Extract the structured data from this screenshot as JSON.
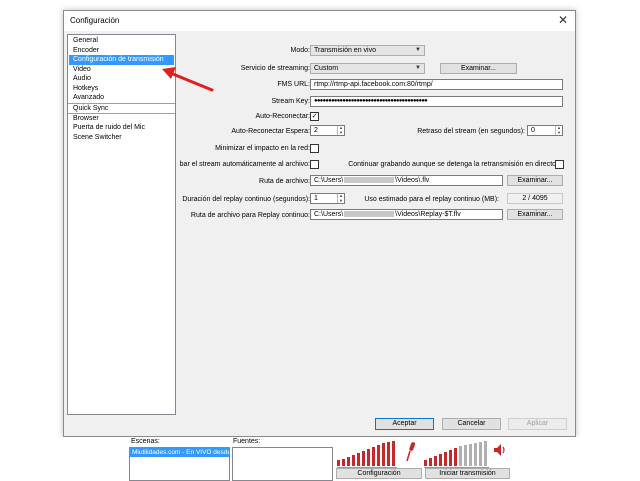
{
  "dialog": {
    "title": "Configuración",
    "close_glyph": "✕"
  },
  "sidebar": {
    "items": [
      {
        "label": "General"
      },
      {
        "label": "Encoder"
      },
      {
        "label": "Configuración de transmisión",
        "selected": true
      },
      {
        "label": "Video"
      },
      {
        "label": "Audio"
      },
      {
        "label": "Hotkeys"
      },
      {
        "label": "Avanzado"
      },
      {
        "label": "Quick Sync"
      },
      {
        "label": "Browser"
      },
      {
        "label": "Puerta de ruido del Mic"
      },
      {
        "label": "Scene Switcher"
      }
    ]
  },
  "form": {
    "modo_label": "Modo:",
    "modo_value": "Transmisión en vivo",
    "servicio_label": "Servicio de streaming:",
    "servicio_value": "Custom",
    "examinar1": "Examinar...",
    "fms_label": "FMS URL:",
    "fms_value": "rtmp://rtmp-api.facebook.com:80/rtmp/",
    "key_label": "Stream Key:",
    "key_value": "●●●●●●●●●●●●●●●●●●●●●●●●●●●●●●●●●●●●●●●●",
    "auto_reconectar_label": "Auto-Reconectar:",
    "auto_reconectar_checked": true,
    "auto_espera_label": "Auto-Reconectar Espera:",
    "auto_espera_value": "2",
    "retraso_label": "Retraso del stream (en segundos):",
    "retraso_value": "0",
    "minimizar_label": "Minimizar el impacto en la red:",
    "minimizar_checked": false,
    "grabar_label": "bar el stream automáticamente al archivo:",
    "grabar_checked": false,
    "continuar_label": "Continuar grabando aunque se detenga la retransmisión en directo:",
    "continuar_checked": false,
    "ruta_label": "Ruta de archivo:",
    "ruta_prefix": "C:\\Users\\",
    "ruta_suffix": "\\Videos\\.flv",
    "examinar2": "Examinar...",
    "duracion_label": "Duración del replay continuo (segundos):",
    "duracion_value": "1",
    "uso_label": "Uso estimado para el replay continuo (MB):",
    "uso_value": "2 / 4095",
    "replay_label": "Ruta de archivo para Replay continuo:",
    "replay_prefix": "C:\\Users\\",
    "replay_suffix": "\\Videos\\Replay-$T.flv",
    "examinar3": "Examinar..."
  },
  "footer": {
    "aceptar": "Aceptar",
    "cancelar": "Cancelar",
    "aplicar": "Aplicar"
  },
  "obs": {
    "escenas_label": "Escenas:",
    "escena_item": "Miutilidades.com - En VIVO desde",
    "fuentes_label": "Fuentes:",
    "configuracion_btn": "Configuración",
    "iniciar_btn": "Iniciar transmisión",
    "mic_icon": "microphone-icon",
    "speaker_icon": "speaker-icon"
  },
  "colors": {
    "selection": "#3399ff",
    "arrow": "#e02020",
    "meter_red": "#c62828"
  }
}
